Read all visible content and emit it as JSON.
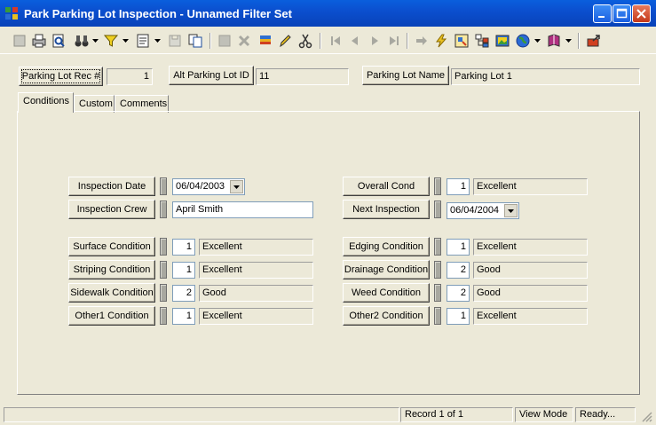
{
  "window": {
    "title": "Park Parking Lot Inspection - Unnamed Filter Set"
  },
  "header": {
    "rec_label": "Parking Lot Rec #",
    "rec_value": "1",
    "alt_label": "Alt Parking Lot ID",
    "alt_value": "11",
    "name_label": "Parking Lot Name",
    "name_value": "Parking Lot 1"
  },
  "tabs": [
    {
      "label": "Conditions"
    },
    {
      "label": "Custom"
    },
    {
      "label": "Comments"
    }
  ],
  "form": {
    "inspection_date_label": "Inspection Date",
    "inspection_date_value": "06/04/2003",
    "inspection_crew_label": "Inspection Crew",
    "inspection_crew_value": "April Smith",
    "overall_cond_label": "Overall Cond",
    "overall_cond_value": "1",
    "overall_cond_text": "Excellent",
    "next_inspection_label": "Next Inspection",
    "next_inspection_value": "06/04/2004",
    "conditions_left": [
      {
        "label": "Surface Condition",
        "value": "1",
        "text": "Excellent"
      },
      {
        "label": "Striping Condition",
        "value": "1",
        "text": "Excellent"
      },
      {
        "label": "Sidewalk Condition",
        "value": "2",
        "text": "Good"
      },
      {
        "label": "Other1 Condition",
        "value": "1",
        "text": "Excellent"
      }
    ],
    "conditions_right": [
      {
        "label": "Edging Condition",
        "value": "1",
        "text": "Excellent"
      },
      {
        "label": "Drainage Condition",
        "value": "2",
        "text": "Good"
      },
      {
        "label": "Weed Condition",
        "value": "2",
        "text": "Good"
      },
      {
        "label": "Other2 Condition",
        "value": "1",
        "text": "Excellent"
      }
    ]
  },
  "status": {
    "record": "Record 1 of 1",
    "mode": "View Mode",
    "state": "Ready..."
  },
  "colors": {
    "title_bar": "#0B4FCF",
    "face": "#ECE9D8",
    "close_button": "#C4381A"
  }
}
